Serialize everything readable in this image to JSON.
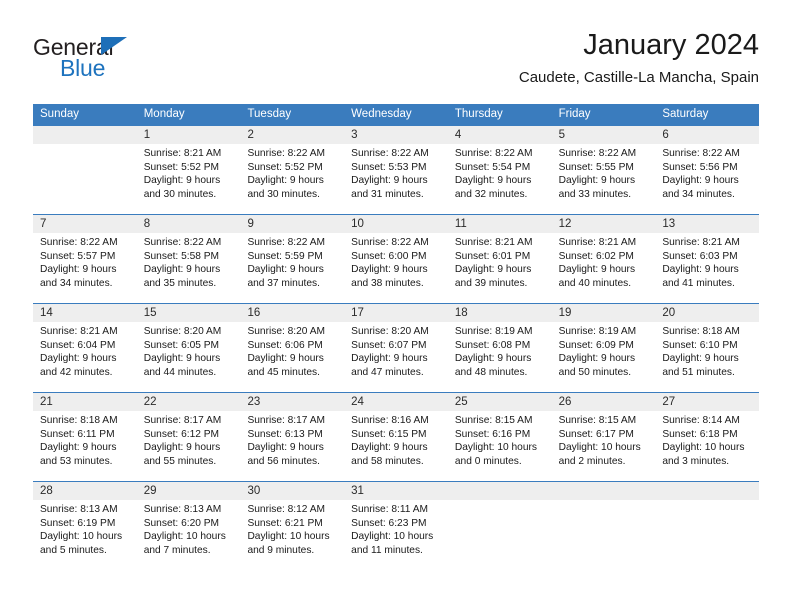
{
  "brand": {
    "name_part1": "General",
    "name_part2": "Blue",
    "accent_color": "#1e73be"
  },
  "header": {
    "title": "January 2024",
    "subtitle": "Caudete, Castille-La Mancha, Spain"
  },
  "calendar": {
    "header_bg_color": "#3a7cbe",
    "weekdays": [
      "Sunday",
      "Monday",
      "Tuesday",
      "Wednesday",
      "Thursday",
      "Friday",
      "Saturday"
    ],
    "weeks": [
      [
        {
          "day": "",
          "lines": [
            "",
            "",
            "",
            ""
          ]
        },
        {
          "day": "1",
          "lines": [
            "Sunrise: 8:21 AM",
            "Sunset: 5:52 PM",
            "Daylight: 9 hours",
            "and 30 minutes."
          ]
        },
        {
          "day": "2",
          "lines": [
            "Sunrise: 8:22 AM",
            "Sunset: 5:52 PM",
            "Daylight: 9 hours",
            "and 30 minutes."
          ]
        },
        {
          "day": "3",
          "lines": [
            "Sunrise: 8:22 AM",
            "Sunset: 5:53 PM",
            "Daylight: 9 hours",
            "and 31 minutes."
          ]
        },
        {
          "day": "4",
          "lines": [
            "Sunrise: 8:22 AM",
            "Sunset: 5:54 PM",
            "Daylight: 9 hours",
            "and 32 minutes."
          ]
        },
        {
          "day": "5",
          "lines": [
            "Sunrise: 8:22 AM",
            "Sunset: 5:55 PM",
            "Daylight: 9 hours",
            "and 33 minutes."
          ]
        },
        {
          "day": "6",
          "lines": [
            "Sunrise: 8:22 AM",
            "Sunset: 5:56 PM",
            "Daylight: 9 hours",
            "and 34 minutes."
          ]
        }
      ],
      [
        {
          "day": "7",
          "lines": [
            "Sunrise: 8:22 AM",
            "Sunset: 5:57 PM",
            "Daylight: 9 hours",
            "and 34 minutes."
          ]
        },
        {
          "day": "8",
          "lines": [
            "Sunrise: 8:22 AM",
            "Sunset: 5:58 PM",
            "Daylight: 9 hours",
            "and 35 minutes."
          ]
        },
        {
          "day": "9",
          "lines": [
            "Sunrise: 8:22 AM",
            "Sunset: 5:59 PM",
            "Daylight: 9 hours",
            "and 37 minutes."
          ]
        },
        {
          "day": "10",
          "lines": [
            "Sunrise: 8:22 AM",
            "Sunset: 6:00 PM",
            "Daylight: 9 hours",
            "and 38 minutes."
          ]
        },
        {
          "day": "11",
          "lines": [
            "Sunrise: 8:21 AM",
            "Sunset: 6:01 PM",
            "Daylight: 9 hours",
            "and 39 minutes."
          ]
        },
        {
          "day": "12",
          "lines": [
            "Sunrise: 8:21 AM",
            "Sunset: 6:02 PM",
            "Daylight: 9 hours",
            "and 40 minutes."
          ]
        },
        {
          "day": "13",
          "lines": [
            "Sunrise: 8:21 AM",
            "Sunset: 6:03 PM",
            "Daylight: 9 hours",
            "and 41 minutes."
          ]
        }
      ],
      [
        {
          "day": "14",
          "lines": [
            "Sunrise: 8:21 AM",
            "Sunset: 6:04 PM",
            "Daylight: 9 hours",
            "and 42 minutes."
          ]
        },
        {
          "day": "15",
          "lines": [
            "Sunrise: 8:20 AM",
            "Sunset: 6:05 PM",
            "Daylight: 9 hours",
            "and 44 minutes."
          ]
        },
        {
          "day": "16",
          "lines": [
            "Sunrise: 8:20 AM",
            "Sunset: 6:06 PM",
            "Daylight: 9 hours",
            "and 45 minutes."
          ]
        },
        {
          "day": "17",
          "lines": [
            "Sunrise: 8:20 AM",
            "Sunset: 6:07 PM",
            "Daylight: 9 hours",
            "and 47 minutes."
          ]
        },
        {
          "day": "18",
          "lines": [
            "Sunrise: 8:19 AM",
            "Sunset: 6:08 PM",
            "Daylight: 9 hours",
            "and 48 minutes."
          ]
        },
        {
          "day": "19",
          "lines": [
            "Sunrise: 8:19 AM",
            "Sunset: 6:09 PM",
            "Daylight: 9 hours",
            "and 50 minutes."
          ]
        },
        {
          "day": "20",
          "lines": [
            "Sunrise: 8:18 AM",
            "Sunset: 6:10 PM",
            "Daylight: 9 hours",
            "and 51 minutes."
          ]
        }
      ],
      [
        {
          "day": "21",
          "lines": [
            "Sunrise: 8:18 AM",
            "Sunset: 6:11 PM",
            "Daylight: 9 hours",
            "and 53 minutes."
          ]
        },
        {
          "day": "22",
          "lines": [
            "Sunrise: 8:17 AM",
            "Sunset: 6:12 PM",
            "Daylight: 9 hours",
            "and 55 minutes."
          ]
        },
        {
          "day": "23",
          "lines": [
            "Sunrise: 8:17 AM",
            "Sunset: 6:13 PM",
            "Daylight: 9 hours",
            "and 56 minutes."
          ]
        },
        {
          "day": "24",
          "lines": [
            "Sunrise: 8:16 AM",
            "Sunset: 6:15 PM",
            "Daylight: 9 hours",
            "and 58 minutes."
          ]
        },
        {
          "day": "25",
          "lines": [
            "Sunrise: 8:15 AM",
            "Sunset: 6:16 PM",
            "Daylight: 10 hours",
            "and 0 minutes."
          ]
        },
        {
          "day": "26",
          "lines": [
            "Sunrise: 8:15 AM",
            "Sunset: 6:17 PM",
            "Daylight: 10 hours",
            "and 2 minutes."
          ]
        },
        {
          "day": "27",
          "lines": [
            "Sunrise: 8:14 AM",
            "Sunset: 6:18 PM",
            "Daylight: 10 hours",
            "and 3 minutes."
          ]
        }
      ],
      [
        {
          "day": "28",
          "lines": [
            "Sunrise: 8:13 AM",
            "Sunset: 6:19 PM",
            "Daylight: 10 hours",
            "and 5 minutes."
          ]
        },
        {
          "day": "29",
          "lines": [
            "Sunrise: 8:13 AM",
            "Sunset: 6:20 PM",
            "Daylight: 10 hours",
            "and 7 minutes."
          ]
        },
        {
          "day": "30",
          "lines": [
            "Sunrise: 8:12 AM",
            "Sunset: 6:21 PM",
            "Daylight: 10 hours",
            "and 9 minutes."
          ]
        },
        {
          "day": "31",
          "lines": [
            "Sunrise: 8:11 AM",
            "Sunset: 6:23 PM",
            "Daylight: 10 hours",
            "and 11 minutes."
          ]
        },
        {
          "day": "",
          "lines": [
            "",
            "",
            "",
            ""
          ]
        },
        {
          "day": "",
          "lines": [
            "",
            "",
            "",
            ""
          ]
        },
        {
          "day": "",
          "lines": [
            "",
            "",
            "",
            ""
          ]
        }
      ]
    ]
  }
}
